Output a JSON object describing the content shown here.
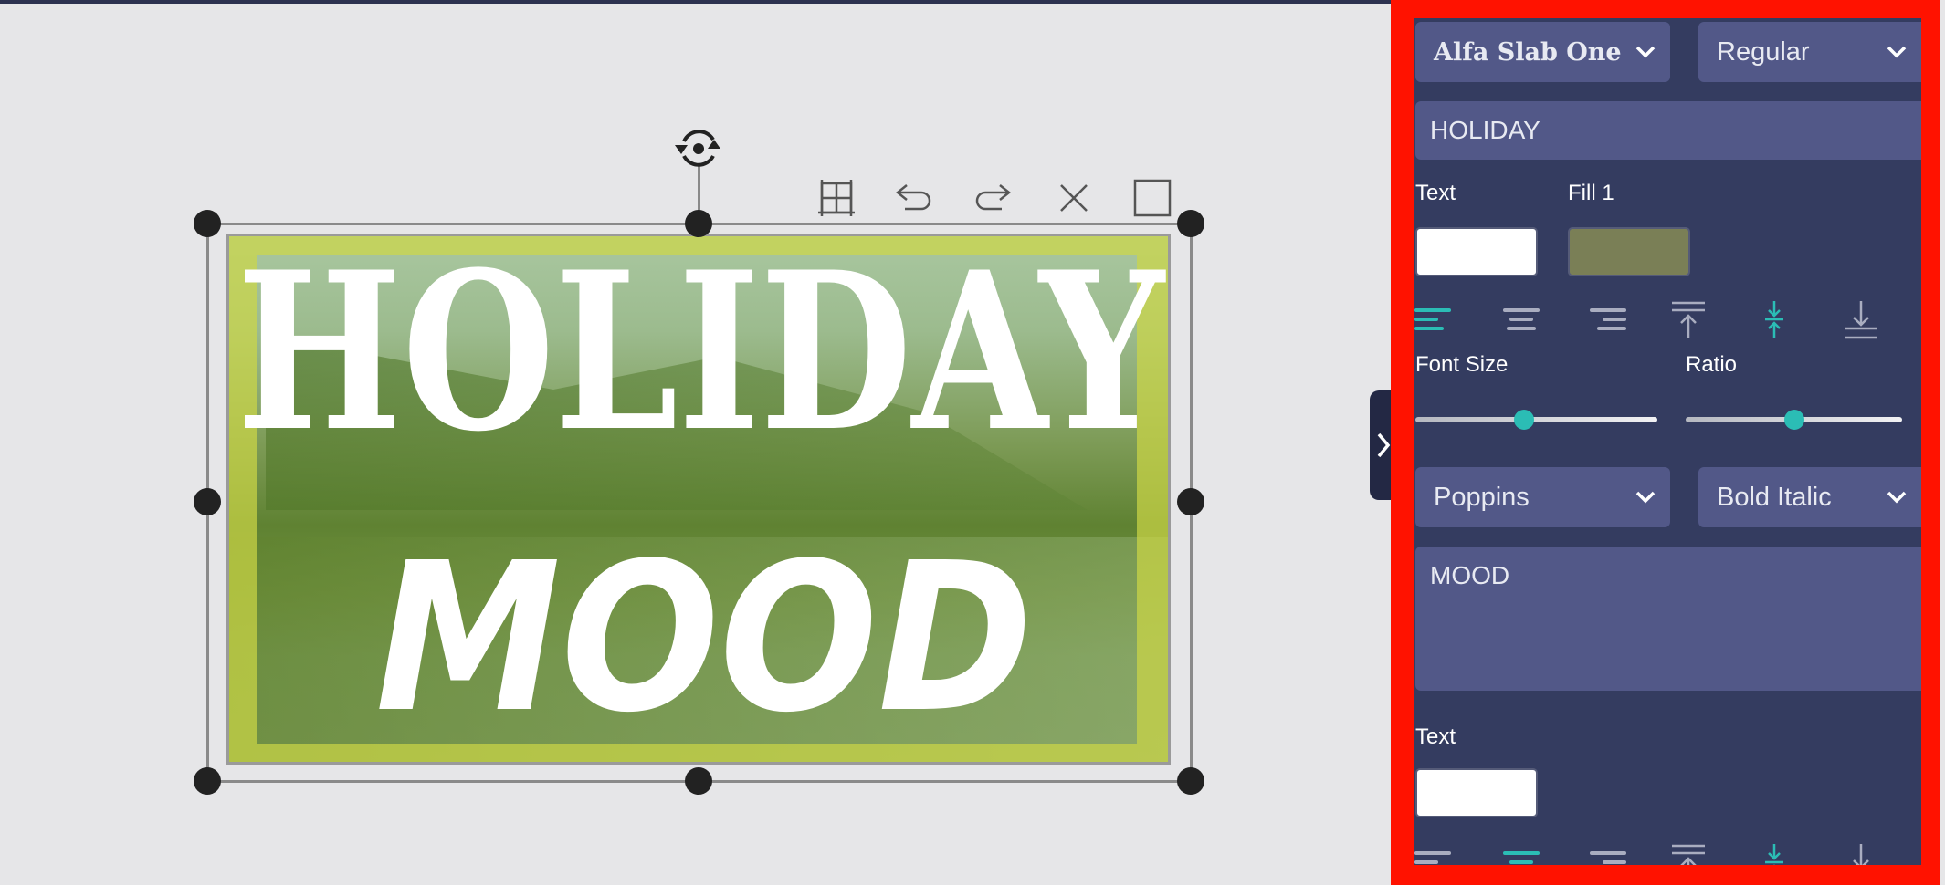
{
  "canvas": {
    "headline": "HOLIDAY",
    "subline": "MOOD",
    "toolbar": [
      "grid-icon",
      "undo-icon",
      "redo-icon",
      "close-icon",
      "square-icon"
    ]
  },
  "panel": {
    "layer1": {
      "font": "Alfa Slab One",
      "style": "Regular",
      "text": "HOLIDAY",
      "text_color_label": "Text",
      "fill_label": "Fill 1",
      "text_color": "#ffffff",
      "fill_color": "#7a7f56",
      "font_size_label": "Font Size",
      "ratio_label": "Ratio",
      "font_size_level": 0.45,
      "ratio_level": 0.5,
      "active_align": "left",
      "active_valign": "middle"
    },
    "layer2": {
      "font": "Poppins",
      "style": "Bold Italic",
      "text": "MOOD",
      "text_color_label": "Text",
      "text_color": "#ffffff",
      "active_align": "center",
      "active_valign": "middle"
    }
  },
  "colors": {
    "accent": "#2bbdb5",
    "panel_bg": "#343c60",
    "highlight_border": "#ff1200"
  }
}
